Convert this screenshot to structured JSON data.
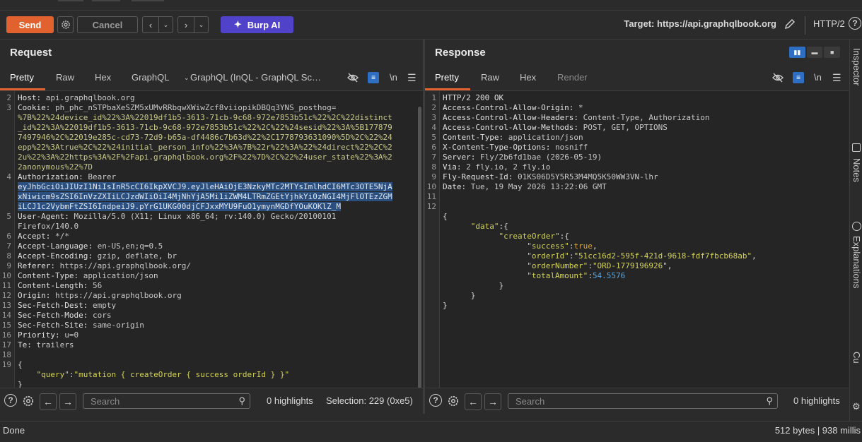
{
  "toolbar": {
    "send_label": "Send",
    "cancel_label": "Cancel",
    "ai_label": "Burp AI",
    "target_label": "Target: https://api.graphqlbook.org",
    "protocol": "HTTP/2",
    "help": "?"
  },
  "request": {
    "title": "Request",
    "tabs": [
      "Pretty",
      "Raw",
      "Hex",
      "GraphQL",
      "GraphQL (InQL - GraphQL Sc…"
    ],
    "active_tab": "Pretty",
    "newline_toggle": "\\n",
    "lines": [
      {
        "n": "2",
        "k": "Host:",
        "v": " api.graphqlbook.org"
      },
      {
        "n": "3",
        "k": "Cookie:",
        "v": " ph_phc_nSTPbaXeSZM5xUMvRRbqwXWiwZcf8viiopikDBQq3YNS_posthog="
      },
      {
        "n": "",
        "c": "%7B%22%24device_id%22%3A%22019df1b5-3613-71cb-9c68-972e7853b51c%22%2C%22distinct"
      },
      {
        "n": "",
        "c": "_id%22%3A%22019df1b5-3613-71cb-9c68-972e7853b51c%22%2C%22%24sesid%22%3A%5B177879"
      },
      {
        "n": "",
        "c": "7497946%2C%22019e285c-cd73-72d9-b65a-df4486c7b63d%22%2C1778793631090%5D%2C%22%24"
      },
      {
        "n": "",
        "c": "epp%22%3Atrue%2C%22%24initial_person_info%22%3A%7B%22r%22%3A%22%24direct%22%2C%2"
      },
      {
        "n": "",
        "c": "2u%22%3A%22https%3A%2F%2Fapi.graphqlbook.org%2F%22%7D%2C%22%24user_state%22%3A%2"
      },
      {
        "n": "",
        "c": "2anonymous%22%7D"
      },
      {
        "n": "4",
        "k": "Authorization:",
        "v": " Bearer"
      },
      {
        "n": "",
        "s": "eyJhbGciOiJIUzI1NiIsInR5cCI6IkpXVCJ9.eyJleHAiOjE3NzkyMTc2MTYsImlhdCI6MTc3OTE5NjA"
      },
      {
        "n": "",
        "s": "xNiwicm9sZSI6InVzZXIiLCJzdWIiOiI4MjNhYjA5Mi1iZWM4LTRmZGEtYjhkYi0zNGI4MjFlOTEzZGM"
      },
      {
        "n": "",
        "s": "iLCJ1c2VybmFtZSI6IndpeiJ9.pYrG1UKG00djCFJxxMYU9FuO1ymynMGDfYOuKOKlZ_M"
      },
      {
        "n": "5",
        "k": "User-Agent:",
        "v": " Mozilla/5.0 (X11; Linux x86_64; rv:140.0) Gecko/20100101"
      },
      {
        "n": "",
        "v": "Firefox/140.0"
      },
      {
        "n": "6",
        "k": "Accept:",
        "v": " */*"
      },
      {
        "n": "7",
        "k": "Accept-Language:",
        "v": " en-US,en;q=0.5"
      },
      {
        "n": "8",
        "k": "Accept-Encoding:",
        "v": " gzip, deflate, br"
      },
      {
        "n": "9",
        "k": "Referer:",
        "v": " https://api.graphqlbook.org/"
      },
      {
        "n": "10",
        "k": "Content-Type:",
        "v": " application/json"
      },
      {
        "n": "11",
        "k": "Content-Length:",
        "v": " 56"
      },
      {
        "n": "12",
        "k": "Origin:",
        "v": " https://api.graphqlbook.org"
      },
      {
        "n": "13",
        "k": "Sec-Fetch-Dest:",
        "v": " empty"
      },
      {
        "n": "14",
        "k": "Sec-Fetch-Mode:",
        "v": " cors"
      },
      {
        "n": "15",
        "k": "Sec-Fetch-Site:",
        "v": " same-origin"
      },
      {
        "n": "16",
        "k": "Priority:",
        "v": " u=0"
      },
      {
        "n": "17",
        "k": "Te:",
        "v": " trailers"
      },
      {
        "n": "18",
        "v": ""
      },
      {
        "n": "19",
        "p": "{"
      },
      {
        "n": "",
        "jk": "    \"query\"",
        "jp": ":",
        "js": "\"mutation { createOrder { success orderId } }\""
      },
      {
        "n": "",
        "p": "}"
      }
    ],
    "search_placeholder": "Search",
    "highlights": "0 highlights",
    "selection": "Selection: 229 (0xe5)"
  },
  "response": {
    "title": "Response",
    "tabs": [
      "Pretty",
      "Raw",
      "Hex",
      "Render"
    ],
    "active_tab": "Pretty",
    "newline_toggle": "\\n",
    "lines": [
      {
        "n": "1",
        "k": "HTTP/2 200 OK",
        "v": ""
      },
      {
        "n": "2",
        "k": "Access-Control-Allow-Origin:",
        "v": " *"
      },
      {
        "n": "3",
        "k": "Access-Control-Allow-Headers:",
        "v": " Content-Type, Authorization"
      },
      {
        "n": "4",
        "k": "Access-Control-Allow-Methods:",
        "v": " POST, GET, OPTIONS"
      },
      {
        "n": "5",
        "k": "Content-Type:",
        "v": " application/json"
      },
      {
        "n": "6",
        "k": "X-Content-Type-Options:",
        "v": " nosniff"
      },
      {
        "n": "7",
        "k": "Server:",
        "v": " Fly/2b6fd1bae (2026-05-19)"
      },
      {
        "n": "8",
        "k": "Via:",
        "v": " 2 fly.io, 2 fly.io"
      },
      {
        "n": "9",
        "k": "Fly-Request-Id:",
        "v": " 01KS06D5Y5R53M4MQ5K50WW3VN-lhr"
      },
      {
        "n": "10",
        "k": "Date:",
        "v": " Tue, 19 May 2026 13:22:06 GMT"
      },
      {
        "n": "11",
        "v": ""
      },
      {
        "n": "12",
        "v": ""
      },
      {
        "n": "",
        "p": "{"
      },
      {
        "n": "",
        "jk": "      \"data\"",
        "jp": ":{"
      },
      {
        "n": "",
        "jk": "            \"createOrder\"",
        "jp": ":{"
      },
      {
        "n": "",
        "jk": "                  \"success\"",
        "jp": ":",
        "jb": "true",
        "jp2": ","
      },
      {
        "n": "",
        "jk": "                  \"orderId\"",
        "jp": ":",
        "js": "\"51cc16d2-595f-421d-9618-fdf7fbcb68ab\"",
        "jp2": ","
      },
      {
        "n": "",
        "jk": "                  \"orderNumber\"",
        "jp": ":",
        "js": "\"ORD-1779196926\"",
        "jp2": ","
      },
      {
        "n": "",
        "jk": "                  \"totalAmount\"",
        "jp": ":",
        "jn": "54.5576"
      },
      {
        "n": "",
        "p": "            }"
      },
      {
        "n": "",
        "p": "      }"
      },
      {
        "n": "",
        "p": "}"
      }
    ],
    "search_placeholder": "Search",
    "highlights": "0 highlights"
  },
  "sidebar": {
    "items": [
      "Inspector",
      "Notes",
      "Explanations",
      "Cu"
    ]
  },
  "status": {
    "left": "Done",
    "right": "512 bytes | 938 millis"
  }
}
